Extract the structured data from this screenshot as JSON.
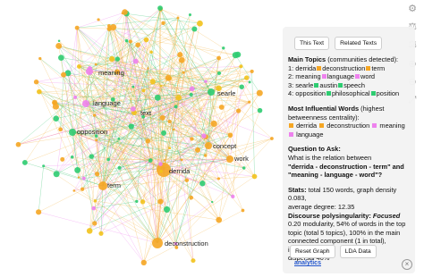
{
  "panel": {
    "tabs": [
      "This Text",
      "Related Texts"
    ],
    "main_topics": {
      "heading": "Main Topics",
      "subheading": "(communities detected):",
      "topics": [
        {
          "num": "1:",
          "words": [
            "derrida",
            "deconstruction",
            "term"
          ]
        },
        {
          "num": "2:",
          "words": [
            "meaning",
            "language",
            "word"
          ]
        },
        {
          "num": "3:",
          "words": [
            "searle",
            "austin",
            "speech"
          ]
        },
        {
          "num": "4:",
          "words": [
            "opposition",
            "philosophical",
            "position"
          ]
        }
      ]
    },
    "influential": {
      "heading": "Most Influential Words",
      "subheading": "(highest betweenness centrality):",
      "words": [
        "derrida",
        "deconstruction",
        "meaning",
        "language"
      ]
    },
    "question": {
      "heading": "Question to Ask:",
      "line1": "What is the relation between",
      "line2": "\"derrida - deconstruction - term\" and",
      "line3": "\"meaning - language - word\"?"
    },
    "stats": {
      "label": "Stats:",
      "text1": " total 150 words, graph density 0.083,",
      "text2": "average degree: 12.35"
    },
    "discourse": {
      "label": "Discourse polysingularity:",
      "value": "Focused",
      "line1": "0.20 modularity, 54% of words in the top",
      "line2": "topic (total 5 topics), 100% in the main",
      "line3": "connected component (1 in total), influence",
      "line4": "dispersal 40%"
    },
    "footer": {
      "reset": "Reset Graph",
      "lda": "LDA Data",
      "analytics": "analytics",
      "close": "×"
    }
  },
  "graph": {
    "colors": {
      "orange": "#f5a623",
      "pink": "#ee82ee",
      "green": "#2ecc71",
      "yellow": "#f2c21b",
      "edge_orange": "#f5b547",
      "edge_green": "#35c46f"
    },
    "labels": {
      "meaning": "meaning",
      "language": "language",
      "text": "text",
      "searle": "searle",
      "opposition": "opposition",
      "concept": "concept",
      "derrida": "derrida",
      "work": "work",
      "term": "term",
      "deconstruction": "deconstruction"
    }
  }
}
